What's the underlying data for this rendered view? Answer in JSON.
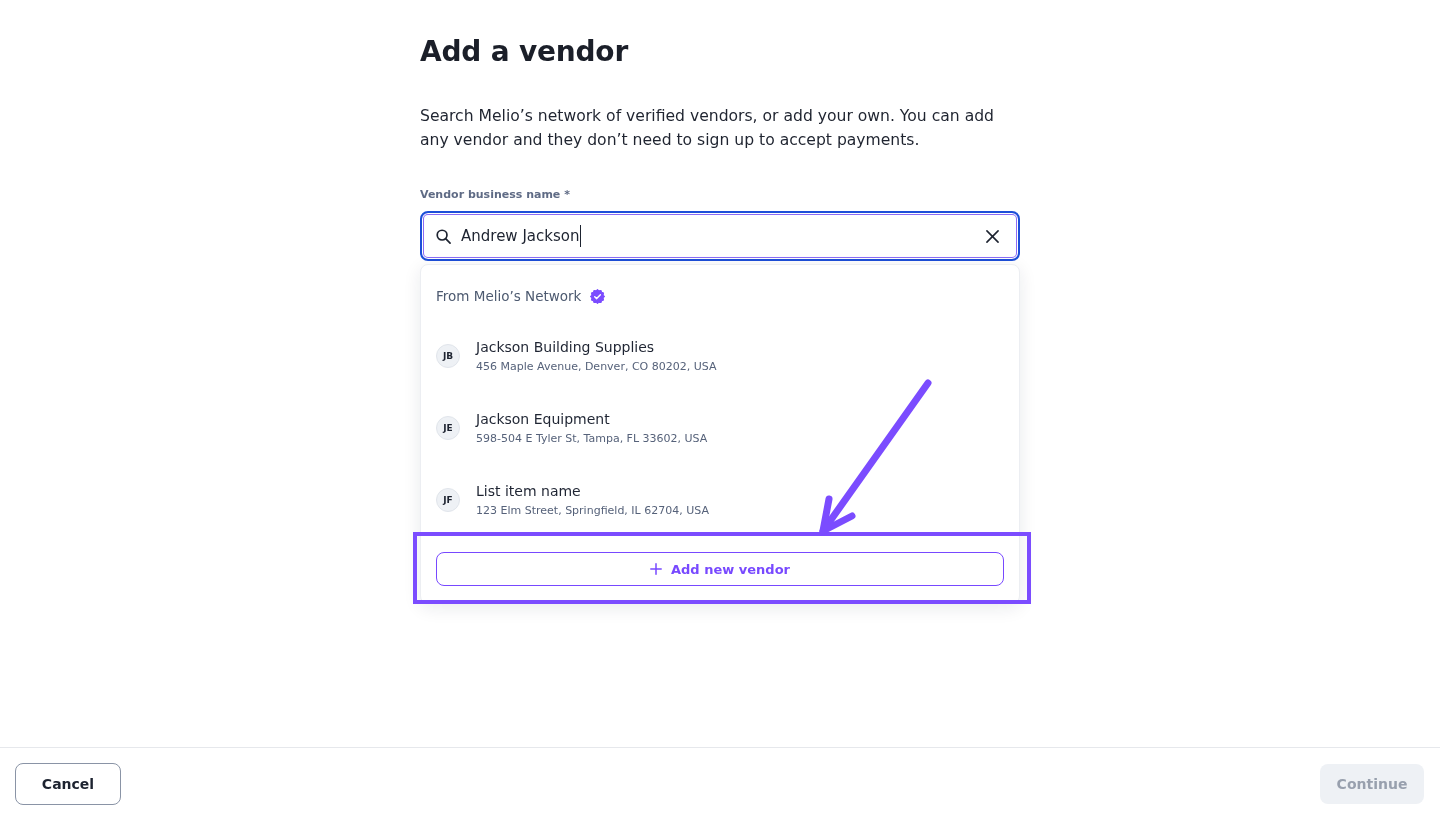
{
  "page": {
    "title": "Add a vendor",
    "description": "Search Melio’s network of verified vendors, or add your own. You can add any vendor and they don’t need to sign up to accept payments."
  },
  "vendor_field": {
    "label": "Vendor business name *",
    "value": "Andrew Jackson",
    "focused": true
  },
  "suggestions": {
    "heading": "From Melio’s Network",
    "verified": true,
    "items": [
      {
        "initials": "JB",
        "name": "Jackson Building Supplies",
        "address": "456 Maple Avenue, Denver, CO 80202, USA",
        "selected": false
      },
      {
        "initials": "JE",
        "name": "Jackson Equipment",
        "address": "598-504 E Tyler St, Tampa, FL 33602, USA",
        "selected": false
      },
      {
        "initials": "JF",
        "name": "List item name",
        "address": "123 Elm Street, Springfield, IL 62704, USA",
        "selected": false
      }
    ],
    "add_button": "Add new vendor"
  },
  "footer": {
    "buttons": [
      {
        "label": "Cancel",
        "kind": "secondary",
        "disabled": false
      },
      {
        "label": "Continue",
        "kind": "primary",
        "disabled": true
      }
    ]
  }
}
